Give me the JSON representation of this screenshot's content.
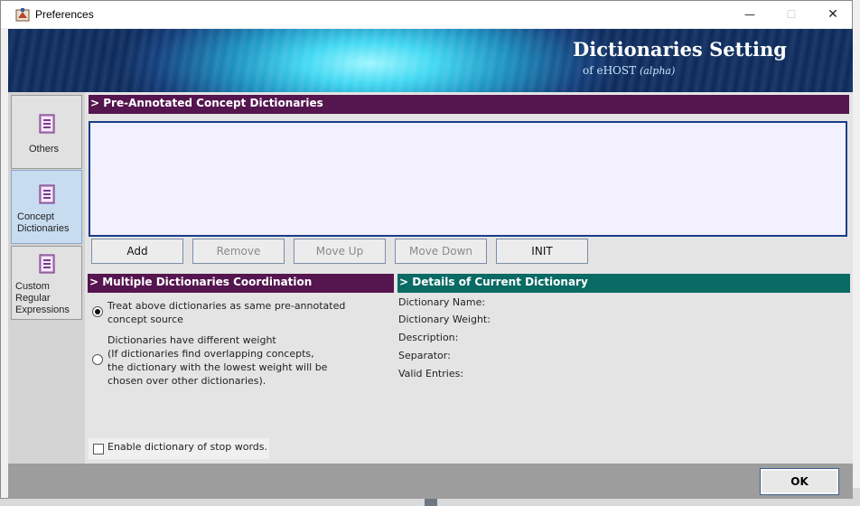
{
  "window": {
    "title": "Preferences",
    "controls": {
      "minimize": "—",
      "maximize": "☐",
      "close": "✕"
    }
  },
  "banner": {
    "title": "Dictionaries Setting",
    "subtitle": "of eHOST",
    "subtitle_tag": "(alpha)"
  },
  "sidebar": {
    "items": [
      {
        "label": "Others",
        "icon": "book-icon",
        "selected": false
      },
      {
        "label": "Concept Dictionaries",
        "icon": "book-icon",
        "selected": true
      },
      {
        "label": "Custom Regular Expressions",
        "icon": "book-icon",
        "selected": false
      }
    ]
  },
  "dictionaries_section": {
    "header": "> Pre-Annotated Concept Dictionaries",
    "items": [],
    "buttons": {
      "add": "Add",
      "remove": "Remove",
      "move_up": "Move Up",
      "move_down": "Move Down",
      "init": "INIT"
    }
  },
  "coordination": {
    "header": "> Multiple Dictionaries Coordination",
    "options": [
      {
        "line1": "Treat above dictionaries as same pre-annotated",
        "line2": "concept source",
        "selected": true
      },
      {
        "line1": "Dictionaries have different weight",
        "line2": "(If dictionaries find overlapping concepts,",
        "line3": "the dictionary with the lowest weight will be",
        "line4": "chosen over other dictionaries).",
        "selected": false
      }
    ]
  },
  "details": {
    "header": "> Details of Current Dictionary",
    "fields": {
      "name": "Dictionary Name:",
      "weight": "Dictionary Weight:",
      "description": "Description:",
      "separator": "Separator:",
      "valid_entries": "Valid Entries:"
    }
  },
  "stop_words": {
    "label": "Enable dictionary of stop words.",
    "checked": false
  },
  "footer": {
    "ok_label": "OK"
  },
  "colors": {
    "section_purple": "#55154f",
    "section_teal": "#0a6a64",
    "list_border": "#1a3d8a",
    "selected_nav": "#c8dcf0"
  }
}
